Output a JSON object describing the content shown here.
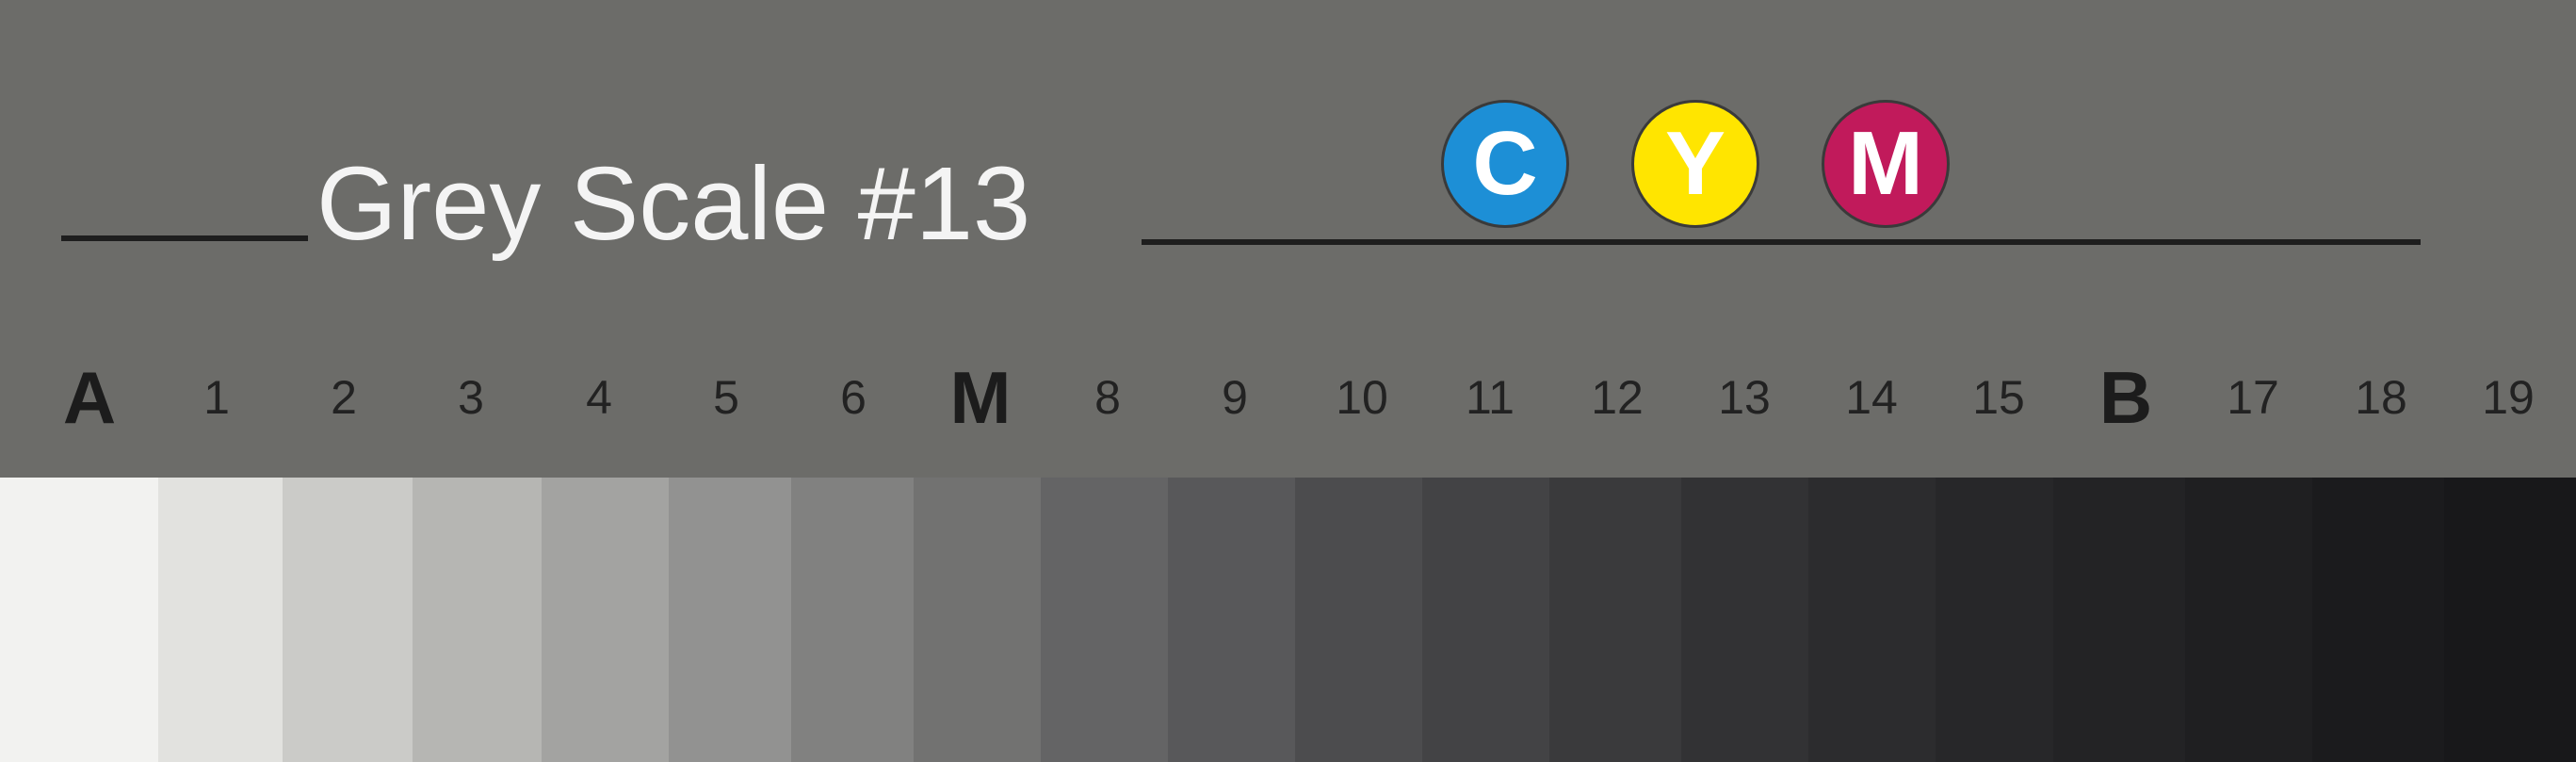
{
  "title": "Grey Scale #13",
  "cym": [
    {
      "letter": "C",
      "bg": "#1d8fd6",
      "fg": "#ffffff"
    },
    {
      "letter": "Y",
      "bg": "#ffe500",
      "fg": "#ffffff"
    },
    {
      "letter": "M",
      "bg": "#c11a5b",
      "fg": "#ffffff"
    }
  ],
  "patches": [
    {
      "label": "A",
      "bold": true,
      "color": "#f2f2f0"
    },
    {
      "label": "1",
      "bold": false,
      "color": "#e2e2df"
    },
    {
      "label": "2",
      "bold": false,
      "color": "#cbcbc8"
    },
    {
      "label": "3",
      "bold": false,
      "color": "#b6b6b3"
    },
    {
      "label": "4",
      "bold": false,
      "color": "#a3a3a1"
    },
    {
      "label": "5",
      "bold": false,
      "color": "#929291"
    },
    {
      "label": "6",
      "bold": false,
      "color": "#818180"
    },
    {
      "label": "M",
      "bold": true,
      "color": "#727271"
    },
    {
      "label": "8",
      "bold": false,
      "color": "#646465"
    },
    {
      "label": "9",
      "bold": false,
      "color": "#58585a"
    },
    {
      "label": "10",
      "bold": false,
      "color": "#4c4c4e"
    },
    {
      "label": "11",
      "bold": false,
      "color": "#434345"
    },
    {
      "label": "12",
      "bold": false,
      "color": "#3a3a3c"
    },
    {
      "label": "13",
      "bold": false,
      "color": "#323234"
    },
    {
      "label": "14",
      "bold": false,
      "color": "#2c2c2e"
    },
    {
      "label": "15",
      "bold": false,
      "color": "#272729"
    },
    {
      "label": "B",
      "bold": true,
      "color": "#232325"
    },
    {
      "label": "17",
      "bold": false,
      "color": "#1f1f21"
    },
    {
      "label": "18",
      "bold": false,
      "color": "#1b1b1d"
    },
    {
      "label": "19",
      "bold": false,
      "color": "#18181a"
    }
  ]
}
